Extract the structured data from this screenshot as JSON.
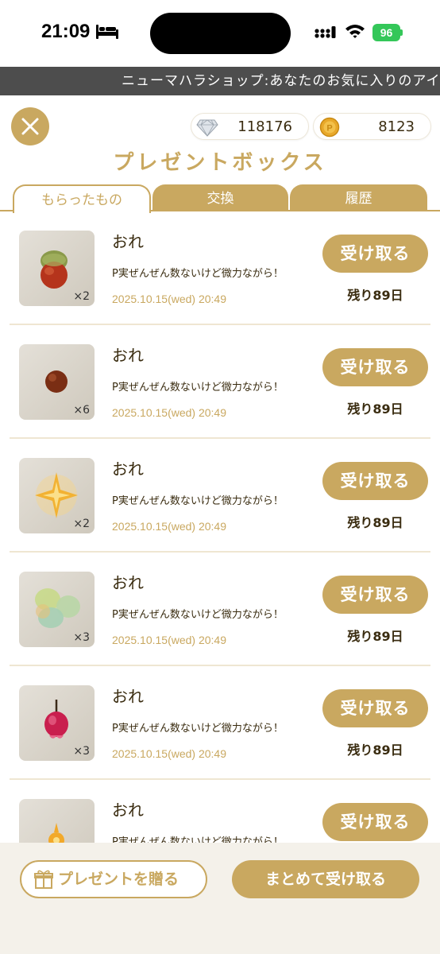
{
  "status_bar": {
    "time": "21:09",
    "battery": "96"
  },
  "ticker": {
    "text": "ニューマハラショップ:あなたのお気に入りのアイテ"
  },
  "currency": {
    "gems": "118176",
    "coins": "8123"
  },
  "page": {
    "title": "プレゼントボックス"
  },
  "tabs": [
    {
      "label": "もらったもの",
      "active": true
    },
    {
      "label": "交換",
      "active": false
    },
    {
      "label": "履歴",
      "active": false
    }
  ],
  "items": [
    {
      "name": "おれ",
      "message": "P実ぜんぜん数ないけど微力ながら！",
      "date": "2025.10.15(wed) 20:49",
      "qty": "×2",
      "button": "受け取る",
      "remaining": "残り89日",
      "icon": "acorn-icon"
    },
    {
      "name": "おれ",
      "message": "P実ぜんぜん数ないけど微力ながら！",
      "date": "2025.10.15(wed) 20:49",
      "qty": "×6",
      "button": "受け取る",
      "remaining": "残り89日",
      "icon": "seed-icon"
    },
    {
      "name": "おれ",
      "message": "P実ぜんぜん数ないけど微力ながら！",
      "date": "2025.10.15(wed) 20:49",
      "qty": "×2",
      "button": "受け取る",
      "remaining": "残り89日",
      "icon": "star-icon"
    },
    {
      "name": "おれ",
      "message": "P実ぜんぜん数ないけど微力ながら！",
      "date": "2025.10.15(wed) 20:49",
      "qty": "×3",
      "button": "受け取る",
      "remaining": "残り89日",
      "icon": "leaf-icon"
    },
    {
      "name": "おれ",
      "message": "P実ぜんぜん数ないけど微力ながら！",
      "date": "2025.10.15(wed) 20:49",
      "qty": "×3",
      "button": "受け取る",
      "remaining": "残り89日",
      "icon": "berry-icon"
    },
    {
      "name": "おれ",
      "message": "P実ぜんぜん数ないけど微力ながら！",
      "date": "",
      "qty": "",
      "button": "受け取る",
      "remaining": "",
      "icon": "flower-icon"
    }
  ],
  "footer": {
    "gift_label": "プレゼントを贈る",
    "receive_all_label": "まとめて受け取る"
  },
  "colors": {
    "accent": "#c9a860",
    "divider": "#efe6d2",
    "footer_bg": "#f4f1ea",
    "ticker_bg": "#4d4d4d"
  }
}
